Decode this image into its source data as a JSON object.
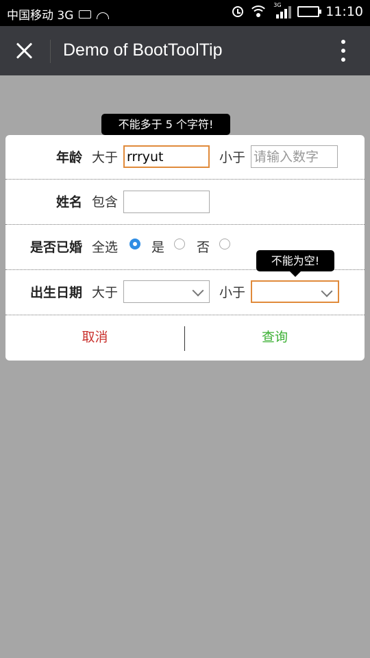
{
  "status_bar": {
    "carrier": "中国移动 3G",
    "network_small": "3G",
    "time": "11:10"
  },
  "title_bar": {
    "title": "Demo of BootToolTip"
  },
  "form": {
    "age": {
      "label": "年龄",
      "greater_text": "大于",
      "greater_value": "rrryut",
      "less_text": "小于",
      "less_placeholder": "请输入数字",
      "tooltip": "不能多于 5 个字符!"
    },
    "name": {
      "label": "姓名",
      "contains_text": "包含",
      "value": ""
    },
    "married": {
      "label": "是否已婚",
      "options": [
        "全选",
        "是",
        "否"
      ],
      "selected": "全选"
    },
    "birthday": {
      "label": "出生日期",
      "greater_text": "大于",
      "less_text": "小于",
      "tooltip": "不能为空!"
    },
    "cancel_label": "取消",
    "query_label": "查询"
  },
  "colors": {
    "background": "#a6a6a6",
    "titlebar": "#393a3f",
    "error_border": "#e08a3a",
    "cancel": "#c9302c",
    "query": "#3cb034",
    "radio_selected": "#2f8de4"
  }
}
